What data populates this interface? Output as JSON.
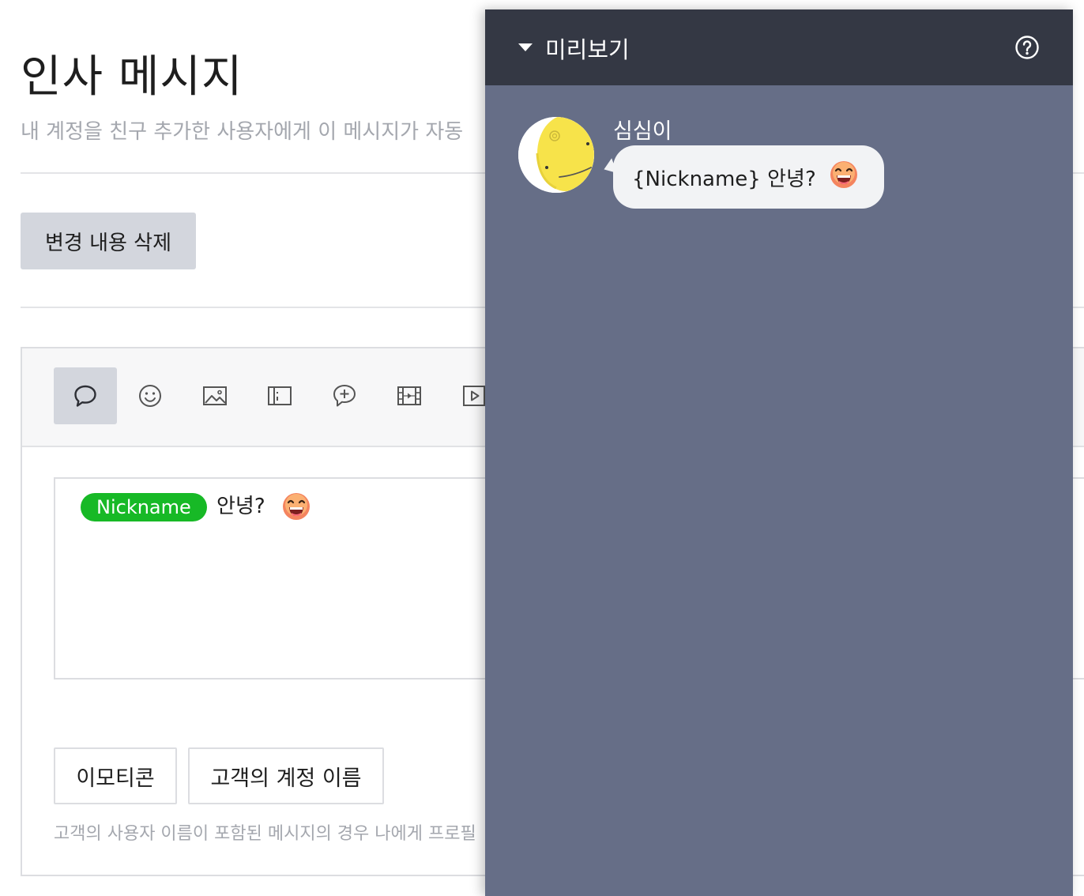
{
  "page": {
    "title": "인사 메시지",
    "description": "내 계정을 친구 추가한 사용자에게 이 메시지가 자동"
  },
  "actions": {
    "delete_changes_label": "변경 내용 삭제"
  },
  "editor": {
    "toolbar": [
      "text-bubble-icon",
      "emoji-smile-icon",
      "image-icon",
      "card-icon",
      "coupon-message-icon",
      "film-icon",
      "video-play-icon"
    ],
    "chip_label": "Nickname",
    "message_text": "안녕?",
    "emoticon_button_label": "이모티콘",
    "account_name_button_label": "고객의 계정 이름",
    "helper_text": "고객의 사용자 이름이 포함된 메시지의 경우 나에게 프로필"
  },
  "preview": {
    "title": "미리보기",
    "sender_name": "심심이",
    "bubble_text": "{Nickname} 안녕?"
  },
  "colors": {
    "chip_green": "#17b926",
    "preview_bg": "#666e87",
    "preview_header": "#343844"
  }
}
